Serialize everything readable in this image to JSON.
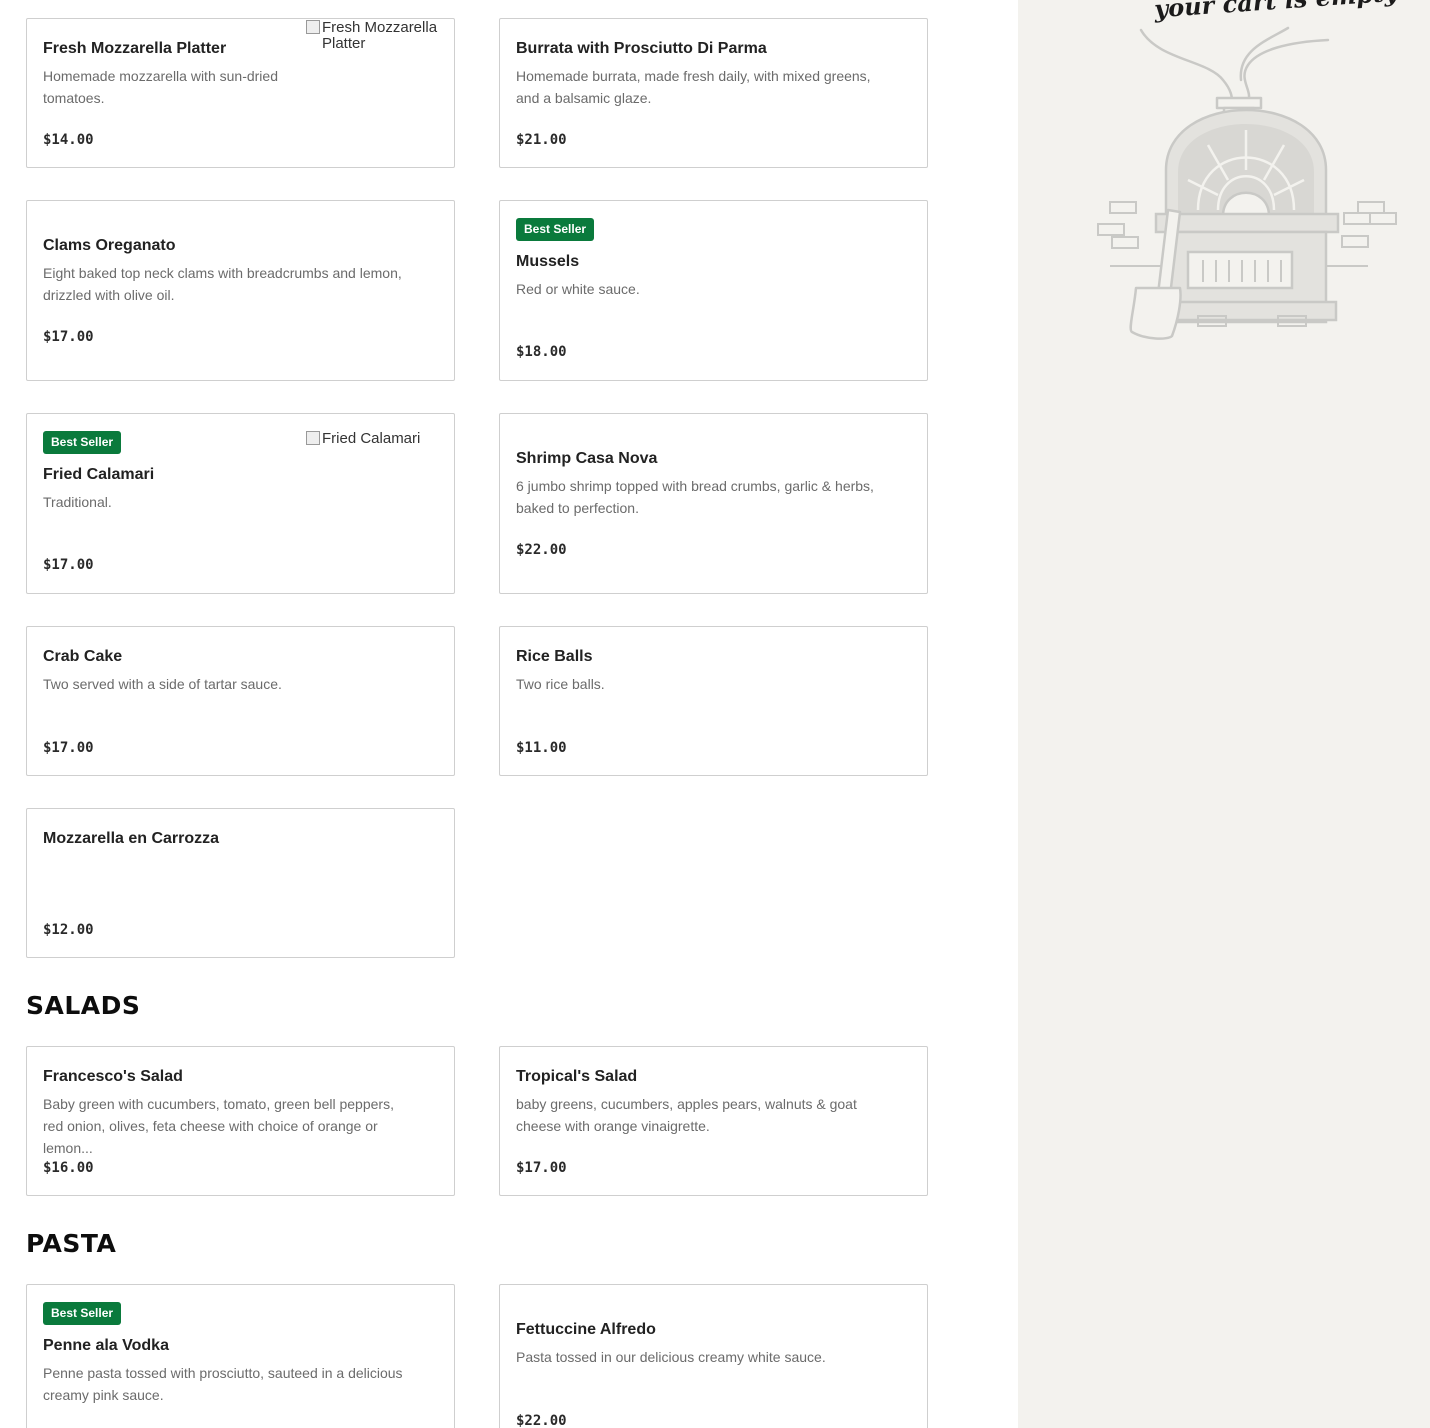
{
  "sections": [
    {
      "title": "SALADS"
    },
    {
      "title": "PASTA"
    }
  ],
  "badge_label": "Best Seller",
  "items": [
    {
      "name": "Fresh Mozzarella Platter",
      "desc": "Homemade mozzarella with sun-dried tomatoes.",
      "price": "$14.00",
      "image_alt": "Fresh Mozzarella Platter"
    },
    {
      "name": "Burrata with Prosciutto Di Parma",
      "desc": "Homemade burrata, made fresh daily, with mixed greens, and a balsamic glaze.",
      "price": "$21.00"
    },
    {
      "name": "Clams Oreganato",
      "desc": "Eight baked top neck clams with breadcrumbs and lemon, drizzled with olive oil.",
      "price": "$17.00"
    },
    {
      "name": "Mussels",
      "desc": "Red or white sauce.",
      "price": "$18.00",
      "badge": true
    },
    {
      "name": "Fried Calamari",
      "desc": "Traditional.",
      "price": "$17.00",
      "badge": true,
      "image_alt": "Fried Calamari"
    },
    {
      "name": "Shrimp Casa Nova",
      "desc": "6 jumbo shrimp topped with bread crumbs, garlic & herbs, baked to perfection.",
      "price": "$22.00"
    },
    {
      "name": "Crab Cake",
      "desc": "Two served with a side of tartar sauce.",
      "price": "$17.00"
    },
    {
      "name": "Rice Balls",
      "desc": "Two rice balls.",
      "price": "$11.00"
    },
    {
      "name": "Mozzarella en Carrozza",
      "desc": "",
      "price": "$12.00"
    },
    {
      "name": "Francesco's Salad",
      "desc": "Baby green with cucumbers, tomato, green bell peppers, red onion, olives, feta cheese with choice of orange or lemon...",
      "price": "$16.00"
    },
    {
      "name": "Tropical's Salad",
      "desc": "baby greens, cucumbers, apples pears, walnuts & goat cheese with orange vinaigrette.",
      "price": "$17.00"
    },
    {
      "name": "Penne ala Vodka",
      "desc": "Penne pasta tossed with prosciutto, sauteed in a delicious creamy pink sauce.",
      "price": "",
      "badge": true
    },
    {
      "name": "Fettuccine Alfredo",
      "desc": "Pasta tossed in our delicious creamy white sauce.",
      "price": "$22.00"
    }
  ],
  "cart": {
    "empty_text": "your cart is empty",
    "illustration_icon": "pizza-oven-icon"
  },
  "colors": {
    "badge": "#0a7a3c",
    "sidebar_bg": "#f3f2ee",
    "card_border": "#cfcfcf"
  }
}
